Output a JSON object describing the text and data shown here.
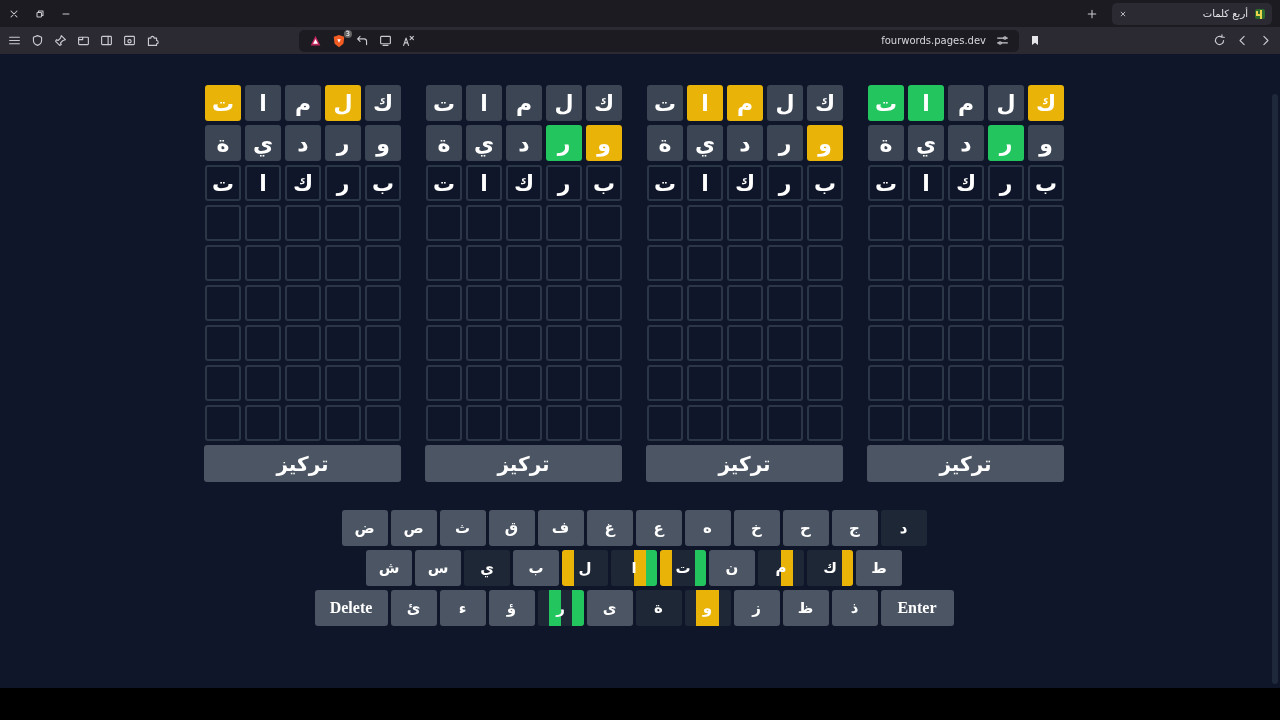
{
  "browser": {
    "tab_title": "أربع كلمات",
    "url": "fourwords.pages.dev",
    "shield_count": "3"
  },
  "boards": [
    {
      "rows": [
        {
          "tiles": [
            {
              "letter": "ك",
              "color": "#eab308"
            },
            {
              "letter": "ل",
              "color": "#3b4554"
            },
            {
              "letter": "م",
              "color": "#3b4554"
            },
            {
              "letter": "ا",
              "color": "#22c55e"
            },
            {
              "letter": "ت",
              "color": "#22c55e"
            }
          ]
        },
        {
          "tiles": [
            {
              "letter": "و",
              "color": "#3b4554"
            },
            {
              "letter": "ر",
              "color": "#22c55e"
            },
            {
              "letter": "د",
              "color": "#3b4554"
            },
            {
              "letter": "ي",
              "color": "#3b4554"
            },
            {
              "letter": "ة",
              "color": "#3b4554"
            }
          ]
        },
        {
          "tiles": [
            {
              "letter": "ب"
            },
            {
              "letter": "ر"
            },
            {
              "letter": "ك"
            },
            {
              "letter": "ا"
            },
            {
              "letter": "ت"
            }
          ]
        }
      ],
      "focus_button": "تركيز"
    },
    {
      "rows": [
        {
          "tiles": [
            {
              "letter": "ك",
              "color": "#3b4554"
            },
            {
              "letter": "ل",
              "color": "#3b4554"
            },
            {
              "letter": "م",
              "color": "#eab308"
            },
            {
              "letter": "ا",
              "color": "#eab308"
            },
            {
              "letter": "ت",
              "color": "#3b4554"
            }
          ]
        },
        {
          "tiles": [
            {
              "letter": "و",
              "color": "#eab308"
            },
            {
              "letter": "ر",
              "color": "#3b4554"
            },
            {
              "letter": "د",
              "color": "#3b4554"
            },
            {
              "letter": "ي",
              "color": "#3b4554"
            },
            {
              "letter": "ة",
              "color": "#3b4554"
            }
          ]
        },
        {
          "tiles": [
            {
              "letter": "ب"
            },
            {
              "letter": "ر"
            },
            {
              "letter": "ك"
            },
            {
              "letter": "ا"
            },
            {
              "letter": "ت"
            }
          ]
        }
      ],
      "focus_button": "تركيز"
    },
    {
      "rows": [
        {
          "tiles": [
            {
              "letter": "ك",
              "color": "#3b4554"
            },
            {
              "letter": "ل",
              "color": "#3b4554"
            },
            {
              "letter": "م",
              "color": "#3b4554"
            },
            {
              "letter": "ا",
              "color": "#3b4554"
            },
            {
              "letter": "ت",
              "color": "#3b4554"
            }
          ]
        },
        {
          "tiles": [
            {
              "letter": "و",
              "color": "#eab308"
            },
            {
              "letter": "ر",
              "color": "#22c55e"
            },
            {
              "letter": "د",
              "color": "#3b4554"
            },
            {
              "letter": "ي",
              "color": "#3b4554"
            },
            {
              "letter": "ة",
              "color": "#3b4554"
            }
          ]
        },
        {
          "tiles": [
            {
              "letter": "ب"
            },
            {
              "letter": "ر"
            },
            {
              "letter": "ك"
            },
            {
              "letter": "ا"
            },
            {
              "letter": "ت"
            }
          ]
        }
      ],
      "focus_button": "تركيز"
    },
    {
      "rows": [
        {
          "tiles": [
            {
              "letter": "ك",
              "color": "#3b4554"
            },
            {
              "letter": "ل",
              "color": "#eab308"
            },
            {
              "letter": "م",
              "color": "#3b4554"
            },
            {
              "letter": "ا",
              "color": "#3b4554"
            },
            {
              "letter": "ت",
              "color": "#eab308"
            }
          ]
        },
        {
          "tiles": [
            {
              "letter": "و",
              "color": "#3b4554"
            },
            {
              "letter": "ر",
              "color": "#3b4554"
            },
            {
              "letter": "د",
              "color": "#3b4554"
            },
            {
              "letter": "ي",
              "color": "#3b4554"
            },
            {
              "letter": "ة",
              "color": "#3b4554"
            }
          ]
        },
        {
          "tiles": [
            {
              "letter": "ب"
            },
            {
              "letter": "ر"
            },
            {
              "letter": "ك"
            },
            {
              "letter": "ا"
            },
            {
              "letter": "ت"
            }
          ]
        }
      ],
      "focus_button": "تركيز"
    }
  ],
  "keyboard": [
    {
      "keys": [
        {
          "label": "د",
          "kind": "letter",
          "used": true,
          "boards": [
            {
              "color": "#1e2736"
            },
            {
              "color": "#1e2736"
            },
            {
              "color": "#1e2736"
            },
            {
              "color": "#1e2736"
            }
          ]
        },
        {
          "label": "ج",
          "kind": "letter",
          "used": false
        },
        {
          "label": "ح",
          "kind": "letter",
          "used": false
        },
        {
          "label": "خ",
          "kind": "letter",
          "used": false
        },
        {
          "label": "ه",
          "kind": "letter",
          "used": false
        },
        {
          "label": "ع",
          "kind": "letter",
          "used": false
        },
        {
          "label": "غ",
          "kind": "letter",
          "used": false
        },
        {
          "label": "ف",
          "kind": "letter",
          "used": false
        },
        {
          "label": "ق",
          "kind": "letter",
          "used": false
        },
        {
          "label": "ث",
          "kind": "letter",
          "used": false
        },
        {
          "label": "ص",
          "kind": "letter",
          "used": false
        },
        {
          "label": "ض",
          "kind": "letter",
          "used": false
        }
      ]
    },
    {
      "keys": [
        {
          "label": "ط",
          "kind": "letter",
          "used": false
        },
        {
          "label": "ك",
          "kind": "letter",
          "used": true,
          "boards": [
            {
              "color": "#eab308"
            },
            {
              "color": "#1e2736"
            },
            {
              "color": "#1e2736"
            },
            {
              "color": "#1e2736"
            }
          ]
        },
        {
          "label": "م",
          "kind": "letter",
          "used": true,
          "boards": [
            {
              "color": "#1e2736"
            },
            {
              "color": "#eab308"
            },
            {
              "color": "#1e2736"
            },
            {
              "color": "#1e2736"
            }
          ]
        },
        {
          "label": "ن",
          "kind": "letter",
          "used": false
        },
        {
          "label": "ت",
          "kind": "letter",
          "used": true,
          "boards": [
            {
              "color": "#22c55e"
            },
            {
              "color": "#1e2736"
            },
            {
              "color": "#1e2736"
            },
            {
              "color": "#eab308"
            }
          ]
        },
        {
          "label": "ا",
          "kind": "letter",
          "used": true,
          "boards": [
            {
              "color": "#22c55e"
            },
            {
              "color": "#eab308"
            },
            {
              "color": "#1e2736"
            },
            {
              "color": "#1e2736"
            }
          ]
        },
        {
          "label": "ل",
          "kind": "letter",
          "used": true,
          "boards": [
            {
              "color": "#1e2736"
            },
            {
              "color": "#1e2736"
            },
            {
              "color": "#1e2736"
            },
            {
              "color": "#eab308"
            }
          ]
        },
        {
          "label": "ب",
          "kind": "letter",
          "used": false
        },
        {
          "label": "ي",
          "kind": "letter",
          "used": true,
          "boards": [
            {
              "color": "#1e2736"
            },
            {
              "color": "#1e2736"
            },
            {
              "color": "#1e2736"
            },
            {
              "color": "#1e2736"
            }
          ]
        },
        {
          "label": "س",
          "kind": "letter",
          "used": false
        },
        {
          "label": "ش",
          "kind": "letter",
          "used": false
        }
      ]
    },
    {
      "keys": [
        {
          "label": "Enter",
          "kind": "action",
          "used": false
        },
        {
          "label": "ذ",
          "kind": "letter",
          "used": false
        },
        {
          "label": "ظ",
          "kind": "letter",
          "used": false
        },
        {
          "label": "ز",
          "kind": "letter",
          "used": false
        },
        {
          "label": "و",
          "kind": "letter",
          "used": true,
          "boards": [
            {
              "color": "#1e2736"
            },
            {
              "color": "#eab308"
            },
            {
              "color": "#eab308"
            },
            {
              "color": "#1e2736"
            }
          ]
        },
        {
          "label": "ة",
          "kind": "letter",
          "used": true,
          "boards": [
            {
              "color": "#1e2736"
            },
            {
              "color": "#1e2736"
            },
            {
              "color": "#1e2736"
            },
            {
              "color": "#1e2736"
            }
          ]
        },
        {
          "label": "ى",
          "kind": "letter",
          "used": false
        },
        {
          "label": "ر",
          "kind": "letter",
          "used": true,
          "boards": [
            {
              "color": "#22c55e"
            },
            {
              "color": "#1e2736"
            },
            {
              "color": "#22c55e"
            },
            {
              "color": "#1e2736"
            }
          ]
        },
        {
          "label": "ؤ",
          "kind": "letter",
          "used": false
        },
        {
          "label": "ء",
          "kind": "letter",
          "used": false
        },
        {
          "label": "ئ",
          "kind": "letter",
          "used": false
        },
        {
          "label": "Delete",
          "kind": "action",
          "used": false
        }
      ]
    }
  ]
}
